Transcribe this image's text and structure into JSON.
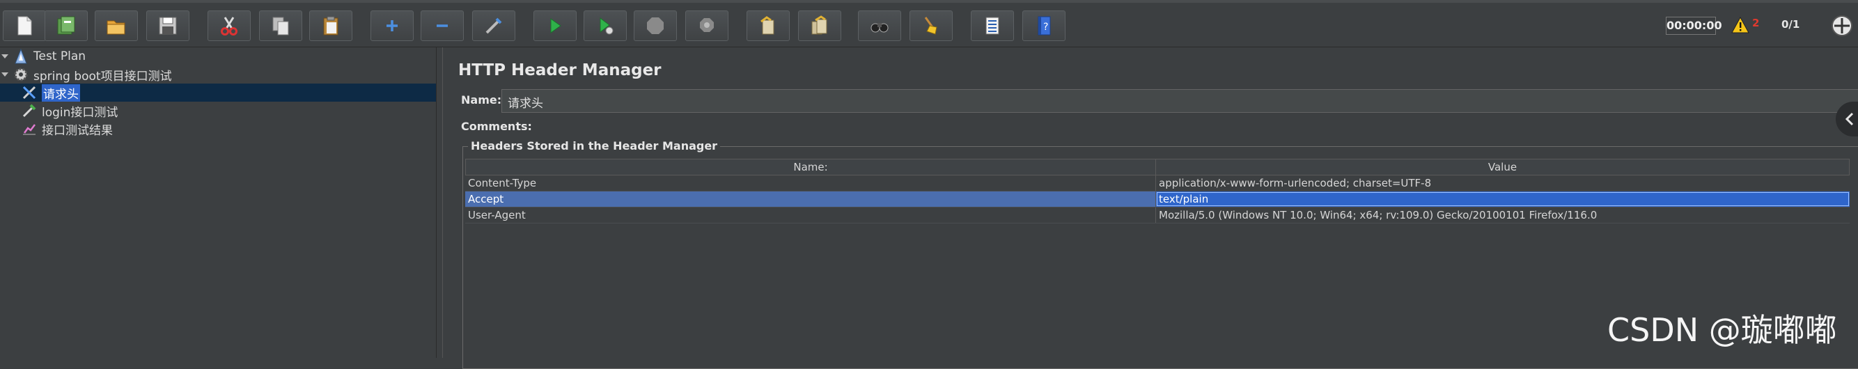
{
  "toolbar": {
    "buttons": [
      {
        "id": "new",
        "icon": "new-icon"
      },
      {
        "id": "templates",
        "icon": "templates-icon"
      },
      {
        "id": "open",
        "icon": "open-icon"
      },
      {
        "id": "save",
        "icon": "save-icon"
      },
      {
        "id": "cut",
        "icon": "cut-icon"
      },
      {
        "id": "copy",
        "icon": "copy-icon"
      },
      {
        "id": "paste",
        "icon": "paste-icon"
      },
      {
        "id": "expand",
        "icon": "plus-icon"
      },
      {
        "id": "collapse",
        "icon": "minus-icon"
      },
      {
        "id": "toggle",
        "icon": "toggle-icon"
      },
      {
        "id": "start",
        "icon": "start-icon"
      },
      {
        "id": "start-no-pause",
        "icon": "start-no-pause-icon"
      },
      {
        "id": "stop",
        "icon": "stop-icon"
      },
      {
        "id": "shutdown",
        "icon": "shutdown-icon"
      },
      {
        "id": "clear",
        "icon": "clear-icon"
      },
      {
        "id": "clear-all",
        "icon": "clear-all-icon"
      },
      {
        "id": "search",
        "icon": "binoculars-icon"
      },
      {
        "id": "reset-search",
        "icon": "broom-icon"
      },
      {
        "id": "function-helper",
        "icon": "function-list-icon"
      },
      {
        "id": "help",
        "icon": "help-book-icon"
      }
    ],
    "colors": {
      "start": "#2fb14a",
      "stop": "#8a8a8a",
      "accent": "#4c8fe0"
    }
  },
  "status": {
    "timer": "00:00:00",
    "warning_count": "2",
    "threads": "0/1"
  },
  "tree": {
    "items": [
      {
        "label": "Test Plan",
        "icon": "test-plan-icon"
      },
      {
        "label": "spring boot项目接口测试",
        "icon": "thread-group-gear-icon"
      },
      {
        "label": "请求头",
        "icon": "header-manager-icon",
        "selected": true
      },
      {
        "label": "login接口测试",
        "icon": "http-sampler-icon"
      },
      {
        "label": "接口测试结果",
        "icon": "results-listener-icon"
      }
    ]
  },
  "editor": {
    "title": "HTTP Header Manager",
    "name_label": "Name:",
    "name_value": "请求头",
    "comments_label": "Comments:",
    "headers_group_title": "Headers Stored in the Header Manager",
    "columns": [
      "Name:",
      "Value"
    ],
    "rows": [
      {
        "name": "Content-Type",
        "value": "application/x-www-form-urlencoded; charset=UTF-8"
      },
      {
        "name": "Accept",
        "value": "text/plain",
        "selected": true
      },
      {
        "name": "User-Agent",
        "value": "Mozilla/5.0 (Windows NT 10.0; Win64; x64; rv:109.0) Gecko/20100101 Firefox/116.0"
      }
    ]
  },
  "watermark": "CSDN @璇嘟嘟"
}
